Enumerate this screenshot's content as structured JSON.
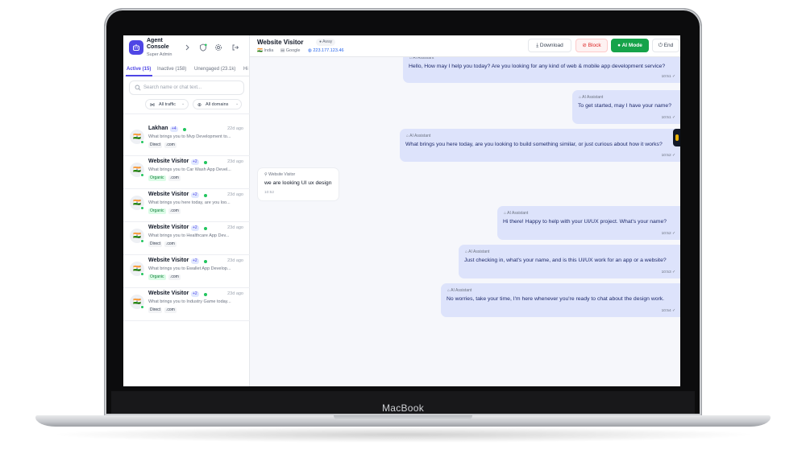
{
  "device": {
    "brand": "MacBook"
  },
  "sidebar": {
    "title": "Agent Console",
    "subtitle": "Super Admin",
    "tabs": [
      {
        "label": "Active (15)",
        "active": true
      },
      {
        "label": "Inactive (158)",
        "active": false
      },
      {
        "label": "Unengaged (23.1k)",
        "active": false
      },
      {
        "label": "Hi",
        "active": false
      }
    ],
    "search_placeholder": "Search name or chat text...",
    "filters": {
      "traffic": "All traffic",
      "domains": "All domains"
    },
    "chats": [
      {
        "name": "Lakhan",
        "badge": "+4",
        "time": "22d ago",
        "message": "What brings you to Mvp Development to...",
        "tags": [
          "Direct",
          ".com"
        ],
        "source": "direct"
      },
      {
        "name": "Website Visitor",
        "badge": "+2",
        "time": "23d ago",
        "message": "What brings you to Car Wash App Devel...",
        "tags": [
          "Organic",
          ".com"
        ],
        "source": "organic"
      },
      {
        "name": "Website Visitor",
        "badge": "+2",
        "time": "23d ago",
        "message": "What brings you here today, are you loo...",
        "tags": [
          "Organic",
          ".com"
        ],
        "source": "organic"
      },
      {
        "name": "Website Visitor",
        "badge": "+2",
        "time": "23d ago",
        "message": "What brings you to Healthcare App Dev...",
        "tags": [
          "Direct",
          ".com"
        ],
        "source": "direct"
      },
      {
        "name": "Website Visitor",
        "badge": "+2",
        "time": "23d ago",
        "message": "What brings you to Ewallet App Develop...",
        "tags": [
          "Organic",
          ".com"
        ],
        "source": "organic"
      },
      {
        "name": "Website Visitor",
        "badge": "+2",
        "time": "23d ago",
        "message": "What brings you to Industry Game today...",
        "tags": [
          "Direct",
          ".com"
        ],
        "source": "direct"
      }
    ]
  },
  "header": {
    "visitor_name": "Website Visitor",
    "status": "Away",
    "country": "India",
    "source": "Google",
    "ip": "223.177.123.46",
    "buttons": {
      "download": "Download",
      "block": "Block",
      "ai_mode": "AI Mode",
      "end": "End"
    }
  },
  "messages": [
    {
      "from": "ai",
      "sender": "AI Assistant",
      "text": "Hello, How may I help you today? Are you looking for any kind of web & mobile app development service?",
      "time": "10:51"
    },
    {
      "from": "ai",
      "sender": "AI Assistant",
      "text": "To get started, may I have your name?",
      "time": "10:51"
    },
    {
      "from": "ai",
      "sender": "AI Assistant",
      "text": "What brings you here today, are you looking to build something similar, or just curious about how it works?",
      "time": "10:52"
    },
    {
      "from": "user",
      "sender": "Website Visitor",
      "text": "we are looking UI ux design",
      "time": "10:52"
    },
    {
      "from": "ai",
      "sender": "AI Assistant",
      "text": "Hi there! Happy to help with your UI/UX project. What's your name?",
      "time": "10:52"
    },
    {
      "from": "ai",
      "sender": "AI Assistant",
      "text": "Just checking in, what's your name, and is this UI/UX work for an app or a website?",
      "time": "10:53"
    },
    {
      "from": "ai",
      "sender": "AI Assistant",
      "text": "No worries, take your time, I'm here whenever you're ready to chat about the design work.",
      "time": "10:54"
    }
  ],
  "colors": {
    "accent": "#4f46e5",
    "ai_bubble": "#dde3fb",
    "online": "#22c55e",
    "ai_mode": "#16a34a",
    "block": "#dc2626"
  }
}
